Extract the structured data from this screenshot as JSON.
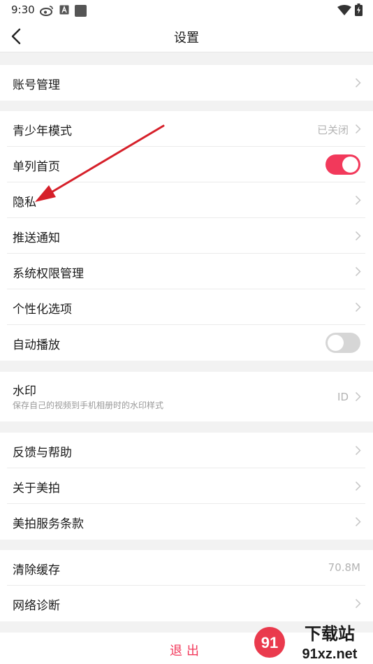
{
  "status": {
    "time": "9:30"
  },
  "nav": {
    "title": "设置"
  },
  "account": {
    "label": "账号管理"
  },
  "teen": {
    "label": "青少年模式",
    "value": "已关闭"
  },
  "single": {
    "label": "单列首页",
    "state": "on"
  },
  "privacy": {
    "label": "隐私"
  },
  "push": {
    "label": "推送通知"
  },
  "perm": {
    "label": "系统权限管理"
  },
  "personal": {
    "label": "个性化选项"
  },
  "autoplay": {
    "label": "自动播放",
    "state": "off"
  },
  "watermark": {
    "label": "水印",
    "sub": "保存自己的视频到手机相册时的水印样式",
    "value": "ID"
  },
  "feedback": {
    "label": "反馈与帮助"
  },
  "about": {
    "label": "关于美拍"
  },
  "terms": {
    "label": "美拍服务条款"
  },
  "cache": {
    "label": "清除缓存",
    "value": "70.8M"
  },
  "network": {
    "label": "网络诊断"
  },
  "logout": {
    "label": "退出"
  },
  "watermark_logo": {
    "text1": "下载站",
    "text2": "91xz.net"
  },
  "colors": {
    "accent": "#f2395b",
    "arrow": "#d6202a"
  }
}
